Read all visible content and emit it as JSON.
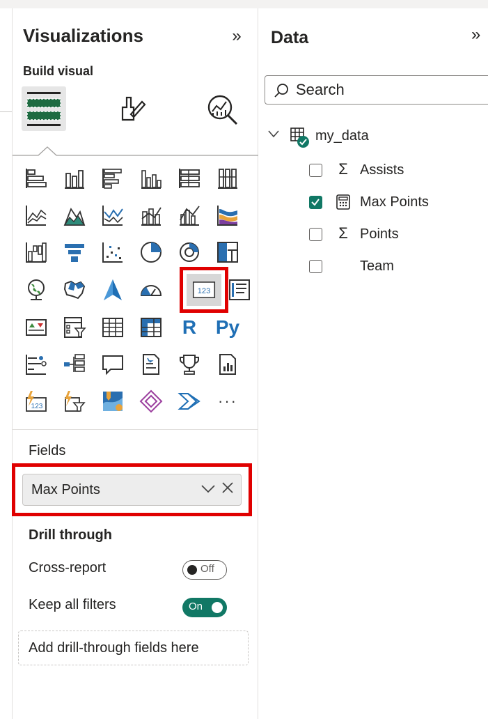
{
  "visualizations": {
    "title": "Visualizations",
    "collapse_icon": "double-chevron-right-icon",
    "build_visual_label": "Build visual",
    "tabs": [
      "build-visual-icon",
      "format-visual-icon",
      "analytics-icon"
    ],
    "gallery_selected": "card-visual",
    "more_label": "···",
    "r_label": "R",
    "py_label": "Py",
    "card_label": "123",
    "fields": {
      "label": "Fields",
      "value": "Max Points"
    },
    "drill_through": {
      "label": "Drill through",
      "cross_report": {
        "label": "Cross-report",
        "toggle": "Off"
      },
      "keep_all_filters": {
        "label": "Keep all filters",
        "toggle": "On"
      },
      "dropzone": "Add drill-through fields here"
    }
  },
  "data_pane": {
    "title": "Data",
    "search_placeholder": "Search",
    "table": {
      "name": "my_data",
      "expanded": true
    },
    "fields": [
      {
        "name": "Assists",
        "checked": false,
        "icon": "Σ"
      },
      {
        "name": "Max Points",
        "checked": true,
        "icon": "calculator"
      },
      {
        "name": "Points",
        "checked": false,
        "icon": "Σ"
      },
      {
        "name": "Team",
        "checked": false,
        "icon": ""
      }
    ]
  },
  "colors": {
    "accent_teal": "#117865",
    "highlight_red": "#e00000",
    "icon_blue": "#1f6fb5",
    "icon_dark": "#3a3a3a"
  }
}
